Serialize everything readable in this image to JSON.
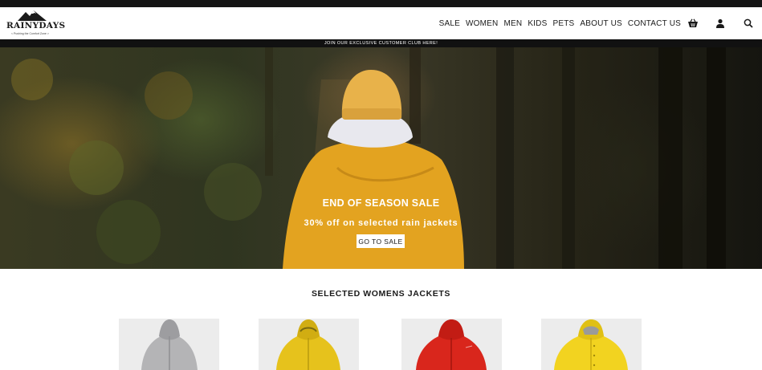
{
  "brand": {
    "name": "RAINYDAYS",
    "tagline": "< Pushing the Comfort Zone >"
  },
  "nav": {
    "items": [
      "SALE",
      "WOMEN",
      "MEN",
      "KIDS",
      "PETS",
      "ABOUT US",
      "CONTACT US"
    ]
  },
  "icons": {
    "basket": "basket-icon",
    "account": "user-icon",
    "search": "search-icon"
  },
  "club_bar": {
    "text": "JOIN OUR EXCLUSIVE CUSTOMER CLUB HERE!"
  },
  "hero": {
    "title": "END OF SEASON SALE",
    "subtitle": "30% off on selected rain jackets",
    "button_label": "GO TO SALE"
  },
  "products_section": {
    "title": "SELECTED WOMENS JACKETS",
    "items": [
      {
        "color_name": "grey",
        "jacket_color": "#b4b4b6"
      },
      {
        "color_name": "yellow",
        "jacket_color": "#e6c21c"
      },
      {
        "color_name": "red",
        "jacket_color": "#d9261c"
      },
      {
        "color_name": "yellow",
        "jacket_color": "#f2d320"
      }
    ]
  },
  "colors": {
    "header_bg": "#ffffff",
    "top_strip": "#151515",
    "club_bar_bg": "#111111",
    "hero_jacket": "#e3a320",
    "text": "#1a1a1a",
    "product_bg": "#ececec"
  }
}
